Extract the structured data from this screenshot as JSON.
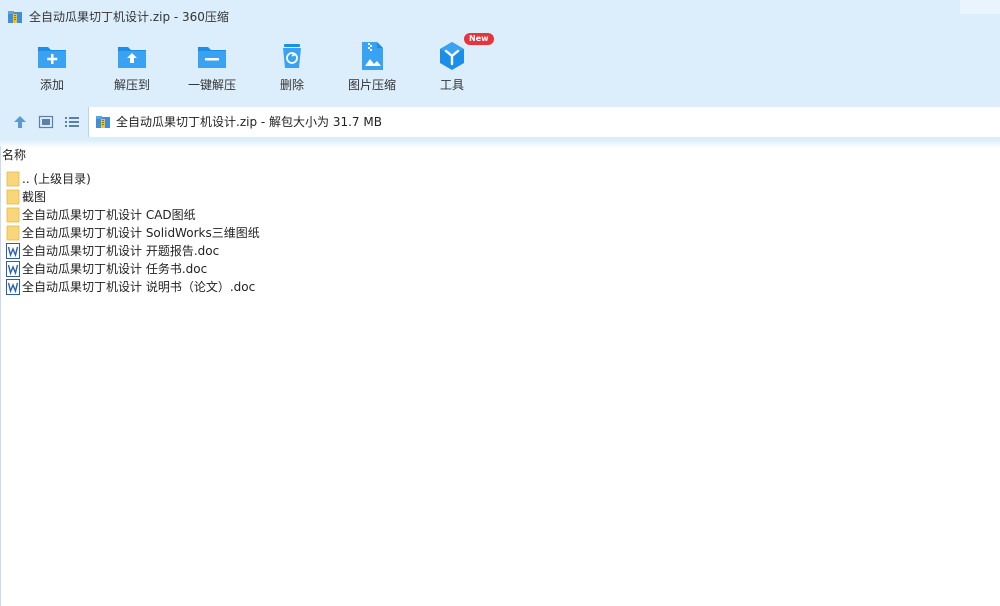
{
  "window": {
    "title": "全自动瓜果切丁机设计.zip - 360压缩"
  },
  "toolbar": {
    "items": [
      {
        "label": "添加",
        "icon": "add-icon"
      },
      {
        "label": "解压到",
        "icon": "extract-to-icon"
      },
      {
        "label": "一键解压",
        "icon": "one-click-extract-icon"
      },
      {
        "label": "删除",
        "icon": "delete-icon"
      },
      {
        "label": "图片压缩",
        "icon": "image-compress-icon"
      },
      {
        "label": "工具",
        "icon": "tools-icon",
        "badge": "New"
      }
    ]
  },
  "navbar": {
    "icons": [
      "up-arrow-icon",
      "thumbnail-view-icon",
      "list-view-icon"
    ],
    "path": "全自动瓜果切丁机设计.zip - 解包大小为 31.7 MB"
  },
  "filelist": {
    "column_header": "名称",
    "rows": [
      {
        "name": ".. (上级目录)",
        "type": "folder"
      },
      {
        "name": "截图",
        "type": "folder"
      },
      {
        "name": "全自动瓜果切丁机设计 CAD图纸",
        "type": "folder"
      },
      {
        "name": "全自动瓜果切丁机设计 SolidWorks三维图纸",
        "type": "folder"
      },
      {
        "name": "全自动瓜果切丁机设计 开题报告.doc",
        "type": "word"
      },
      {
        "name": "全自动瓜果切丁机设计 任务书.doc",
        "type": "word"
      },
      {
        "name": "全自动瓜果切丁机设计 说明书（论文）.doc",
        "type": "word"
      }
    ]
  },
  "colors": {
    "toolbar_bg": "#dceefc",
    "icon_blue": "#1b8ee8",
    "folder_yellow": "#f8d67a",
    "word_blue": "#2b5fb4",
    "badge_red": "#e8323c"
  }
}
